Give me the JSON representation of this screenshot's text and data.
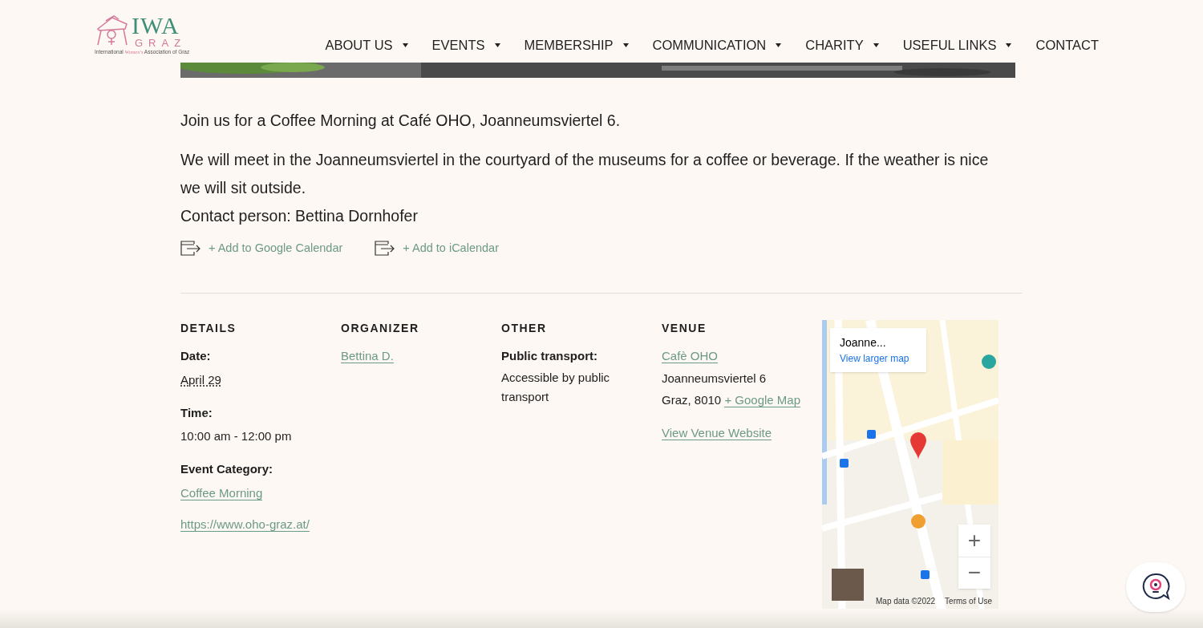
{
  "logo": {
    "title": "IWA",
    "subtitle": "GRAZ",
    "tagline_start": "International ",
    "tagline_accent": "Women's",
    "tagline_end": " Association of Graz"
  },
  "nav": [
    {
      "label": "ABOUT US",
      "has_submenu": true
    },
    {
      "label": "EVENTS",
      "has_submenu": true
    },
    {
      "label": "MEMBERSHIP",
      "has_submenu": true
    },
    {
      "label": "COMMUNICATION",
      "has_submenu": true
    },
    {
      "label": "CHARITY",
      "has_submenu": true
    },
    {
      "label": "USEFUL LINKS",
      "has_submenu": true
    },
    {
      "label": "CONTACT",
      "has_submenu": false
    }
  ],
  "description": [
    "Join us for a Coffee Morning at Café OHO, Joanneumsviertel 6.",
    "We will meet in the Joanneumsviertel in the courtyard of the museums for a coffee or beverage. If the weather is nice we will sit outside.",
    "Contact person: Bettina Dornhofer"
  ],
  "calendar_links": [
    "+ Add to Google Calendar",
    "+ Add to iCalendar"
  ],
  "details": {
    "heading": "DETAILS",
    "date_label": "Date:",
    "date": "April 29",
    "time_label": "Time:",
    "time": "10:00 am - 12:00 pm",
    "category_label": "Event Category:",
    "category": "Coffee Morning",
    "website": "https://www.oho-graz.at/"
  },
  "organizer": {
    "heading": "ORGANIZER",
    "name": "Bettina D."
  },
  "other": {
    "heading": "OTHER",
    "label": "Public transport:",
    "value": "Accessible by public transport"
  },
  "venue": {
    "heading": "VENUE",
    "name": "Cafè OHO",
    "street": "Joanneumsviertel 6",
    "city": "Graz, 8010",
    "map_link": "+ Google Map",
    "website": "View Venue Website"
  },
  "map": {
    "place": "Joanne...",
    "larger_map": "View larger map",
    "zoom_in": "+",
    "zoom_out": "−",
    "attribution": "Map data ©2022",
    "terms": "Terms of Use"
  }
}
